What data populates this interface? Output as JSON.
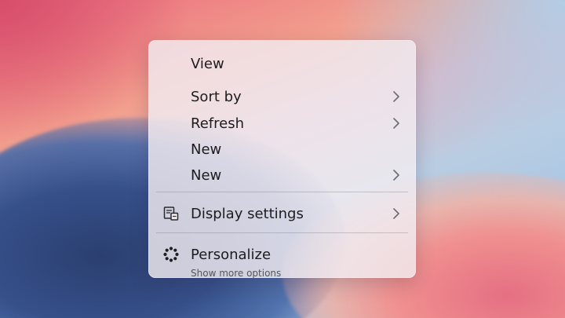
{
  "context_menu": {
    "items": [
      {
        "label": "View"
      },
      {
        "label": "Sort by"
      },
      {
        "label": "Refresh"
      },
      {
        "label": "New"
      },
      {
        "label": "New"
      },
      {
        "label": "Display settings",
        "icon": "display-settings-icon"
      },
      {
        "label": "Personalize",
        "icon": "personalize-icon"
      }
    ],
    "footer_text": "Show more options"
  },
  "colors": {
    "menu_background": "#F2ECF0",
    "text": "#1C1C1E",
    "divider": "#A7A7AD"
  }
}
